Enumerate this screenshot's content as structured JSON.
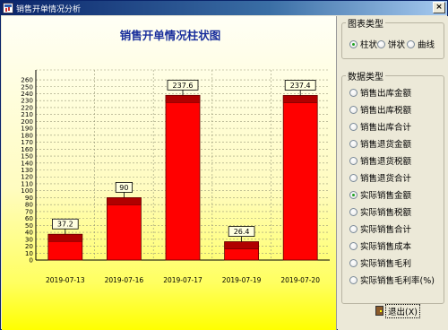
{
  "window": {
    "title": "销售开单情况分析",
    "close_label": "×"
  },
  "chart_panel": {
    "chart_data": {
      "type": "bar",
      "title": "销售开单情况柱状图",
      "categories": [
        "2019-07-13",
        "2019-07-16",
        "2019-07-17",
        "2019-07-19",
        "2019-07-20"
      ],
      "values": [
        37.2,
        90,
        237.6,
        26.4,
        237.4
      ],
      "value_labels": [
        "37.2",
        "90",
        "237.6",
        "26.4",
        "237.4"
      ],
      "yticks": [
        0,
        10,
        20,
        30,
        40,
        50,
        60,
        70,
        80,
        90,
        100,
        110,
        120,
        130,
        140,
        150,
        160,
        170,
        180,
        190,
        200,
        210,
        220,
        230,
        240,
        250,
        260
      ],
      "ylim": [
        0,
        270
      ],
      "grid": true,
      "bar_color": "#ff0000",
      "bar_top_color": "#b00000"
    }
  },
  "chart_type_group": {
    "legend": "图表类型",
    "options": [
      {
        "label": "柱状",
        "checked": true
      },
      {
        "label": "饼状",
        "checked": false
      },
      {
        "label": "曲线",
        "checked": false
      }
    ]
  },
  "data_type_group": {
    "legend": "数据类型",
    "options": [
      {
        "label": "销售出库金额",
        "checked": false
      },
      {
        "label": "销售出库税额",
        "checked": false
      },
      {
        "label": "销售出库合计",
        "checked": false
      },
      {
        "label": "销售退货金额",
        "checked": false
      },
      {
        "label": "销售退货税额",
        "checked": false
      },
      {
        "label": "销售退货合计",
        "checked": false
      },
      {
        "label": "实际销售金额",
        "checked": true
      },
      {
        "label": "实际销售税额",
        "checked": false
      },
      {
        "label": "实际销售合计",
        "checked": false
      },
      {
        "label": "实际销售成本",
        "checked": false
      },
      {
        "label": "实际销售毛利",
        "checked": false
      },
      {
        "label": "实际销售毛利率(%)",
        "checked": false
      }
    ]
  },
  "exit_button": {
    "label": "退出(X)"
  }
}
